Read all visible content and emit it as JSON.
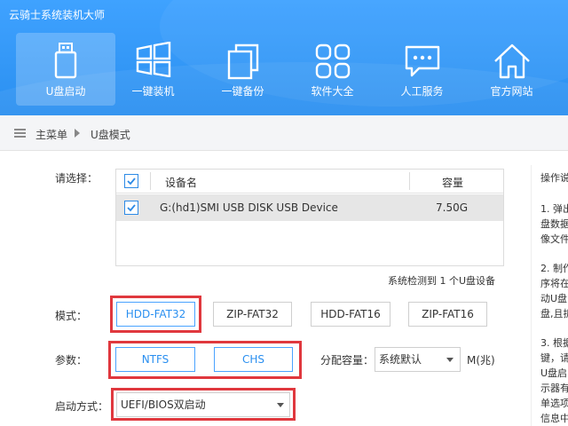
{
  "app": {
    "title": "云骑士系统装机大师"
  },
  "nav": [
    {
      "label": "U盘启动",
      "icon": "usb-drive-icon",
      "active": true
    },
    {
      "label": "一键装机",
      "icon": "windows-icon",
      "active": false
    },
    {
      "label": "一键备份",
      "icon": "backup-icon",
      "active": false
    },
    {
      "label": "软件大全",
      "icon": "apps-grid-icon",
      "active": false
    },
    {
      "label": "人工服务",
      "icon": "chat-icon",
      "active": false
    },
    {
      "label": "官方网站",
      "icon": "home-icon",
      "active": false
    }
  ],
  "breadcrumb": {
    "menu": "主菜单",
    "current": "U盘模式"
  },
  "select_label": "请选择：",
  "device_table": {
    "headers": {
      "name": "设备名",
      "capacity": "容量"
    },
    "rows": [
      {
        "name": "G:(hd1)SMI USB DISK USB Device",
        "capacity": "7.50G",
        "checked": true
      }
    ]
  },
  "detect_text": "系统检测到 1 个U盘设备",
  "mode": {
    "label": "模式：",
    "options": [
      "HDD-FAT32",
      "ZIP-FAT32",
      "HDD-FAT16",
      "ZIP-FAT16"
    ],
    "selected": "HDD-FAT32"
  },
  "params": {
    "label": "参数：",
    "options": [
      "NTFS",
      "CHS"
    ],
    "alloc_label": "分配容量：",
    "alloc_value": "系统默认",
    "alloc_unit": "M(兆)"
  },
  "boot": {
    "label": "启动方式：",
    "value": "UEFI/BIOS双启动"
  },
  "help": {
    "title": "操作说",
    "lines": [
      "1. 弹出",
      "盘数据",
      "像文件",
      "2. 制作",
      "序将在",
      "动U盘",
      "盘,且拆",
      "3. 根据",
      "键，请",
      "U盘启",
      "示器有",
      "单选项",
      "信息中"
    ]
  },
  "colors": {
    "header": "#2a8ff0",
    "accent": "#2d8ae6",
    "highlight": "#e0383e"
  }
}
